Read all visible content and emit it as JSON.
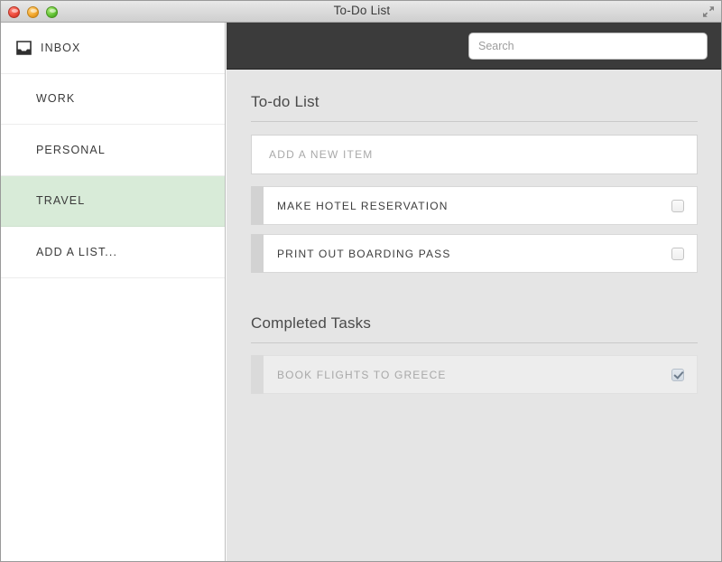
{
  "window": {
    "title": "To-Do List",
    "controls": {
      "close_label": "close",
      "minimize_label": "minimize",
      "maximize_label": "maximize",
      "fullscreen_label": "fullscreen"
    }
  },
  "sidebar": {
    "items": [
      {
        "label": "INBOX",
        "icon": "inbox-icon",
        "selected": false
      },
      {
        "label": "WORK",
        "icon": "",
        "selected": false
      },
      {
        "label": "PERSONAL",
        "icon": "",
        "selected": false
      },
      {
        "label": "TRAVEL",
        "icon": "",
        "selected": true
      },
      {
        "label": "ADD A LIST...",
        "icon": "",
        "selected": false
      }
    ],
    "selected_color": "#d8ebd8"
  },
  "search": {
    "placeholder": "Search",
    "value": ""
  },
  "main": {
    "todo": {
      "heading": "To-do List",
      "new_item_placeholder": "ADD A NEW ITEM",
      "tasks": [
        {
          "label": "MAKE HOTEL RESERVATION",
          "checked": false
        },
        {
          "label": "PRINT OUT BOARDING PASS",
          "checked": false
        }
      ]
    },
    "completed": {
      "heading": "Completed Tasks",
      "tasks": [
        {
          "label": "BOOK FLIGHTS TO GREECE",
          "checked": true
        }
      ]
    }
  },
  "colors": {
    "topbar": "#3b3b3b",
    "content_bg": "#e5e5e5",
    "accent_selected": "#d8ebd8"
  }
}
